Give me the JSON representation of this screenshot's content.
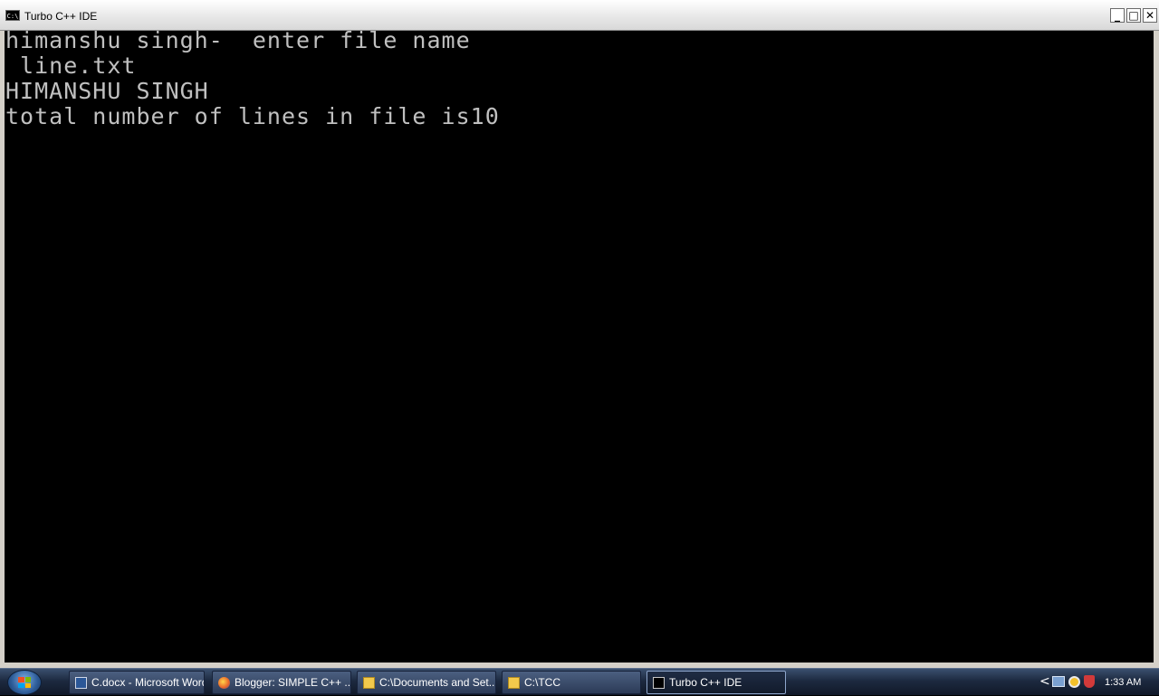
{
  "window": {
    "title": "Turbo C++ IDE",
    "icon_label": "C:\\",
    "minimize_label": "_",
    "maximize_label": "□",
    "close_label": "✕"
  },
  "console": {
    "lines": [
      "himanshu singh-  enter file name",
      " line.txt",
      "HIMANSHU SINGH",
      "total number of lines in file is10"
    ]
  },
  "taskbar": {
    "items": [
      {
        "label": "C.docx - Microsoft Word",
        "icon": "word-icon"
      },
      {
        "label": "Blogger: SIMPLE C++ ...",
        "icon": "firefox-icon"
      },
      {
        "label": "C:\\Documents and Set...",
        "icon": "folder-icon"
      },
      {
        "label": "C:\\TCC",
        "icon": "folder-icon"
      },
      {
        "label": "Turbo C++ IDE",
        "icon": "console-icon",
        "active": true
      }
    ],
    "tray": {
      "chevron": "<",
      "clock": "1:33 AM"
    }
  },
  "colors": {
    "console_bg": "#000000",
    "console_fg": "#c0c0c0",
    "taskbar": "#1d2a40"
  }
}
